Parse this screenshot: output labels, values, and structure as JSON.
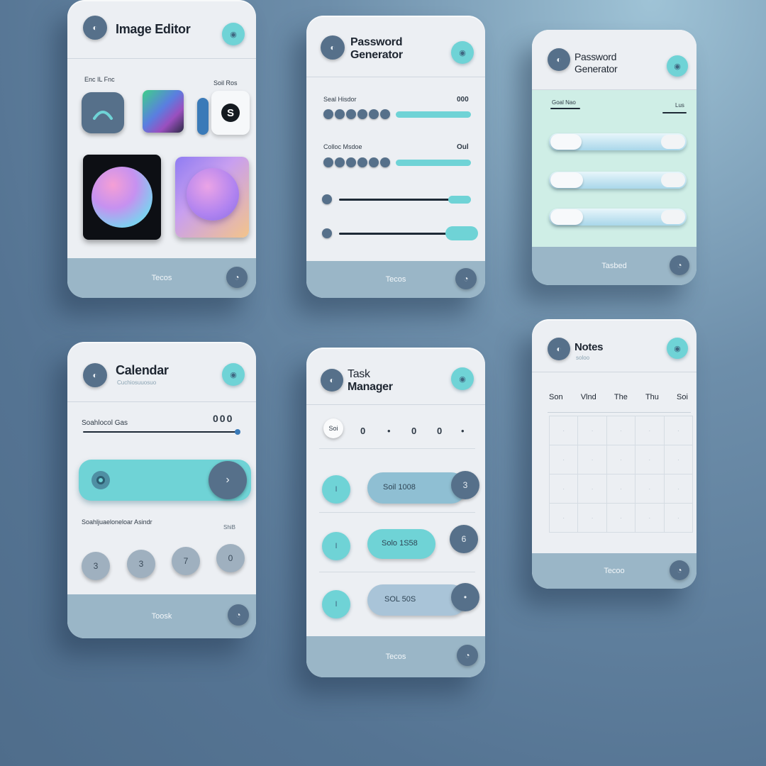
{
  "image_editor": {
    "title": "Image Editor",
    "label_left": "Enc IL Fnc",
    "label_right": "Soil Ros",
    "footer": "Tecos"
  },
  "password_generator_1": {
    "title_line1": "Password",
    "title_line2": "Generator",
    "row1_label": "Seal Hisdor",
    "row1_value": "000",
    "row2_label": "Colloc Msdoe",
    "row2_value": "Oul",
    "footer": "Tecos"
  },
  "password_generator_2": {
    "title_line1": "Password",
    "title_line2": "Generator",
    "label_left": "Goal Nao",
    "label_right": "Lus",
    "footer": "Tasbed"
  },
  "calendar": {
    "title": "Calendar",
    "subtitle": "Cuchiosuuosuo",
    "slider_label": "Soahlocol Gas",
    "slider_value": "000",
    "row_label": "Soahljuaeloneloar Asindr",
    "row_label_right": "ShiB",
    "circles": [
      "3",
      "3",
      "7",
      "0"
    ],
    "footer": "Toosk"
  },
  "task_manager": {
    "title_line1": "Task",
    "title_line2": "Manager",
    "top_chip": "Soi",
    "top_items": [
      "0",
      "•",
      "0",
      "0",
      "•"
    ],
    "rows": [
      {
        "check": "I",
        "label": "Soil 1008",
        "end": "3"
      },
      {
        "check": "I",
        "label": "Solo 1S58",
        "end": "6"
      },
      {
        "check": "I",
        "label": "SOL 50S",
        "end": "•"
      }
    ],
    "footer": "Tecos"
  },
  "notes": {
    "title": "Notes",
    "subtitle": "soloo",
    "days": [
      "Son",
      "Vlnd",
      "The",
      "Thu",
      "Soi"
    ],
    "footer": "Tecoo"
  }
}
